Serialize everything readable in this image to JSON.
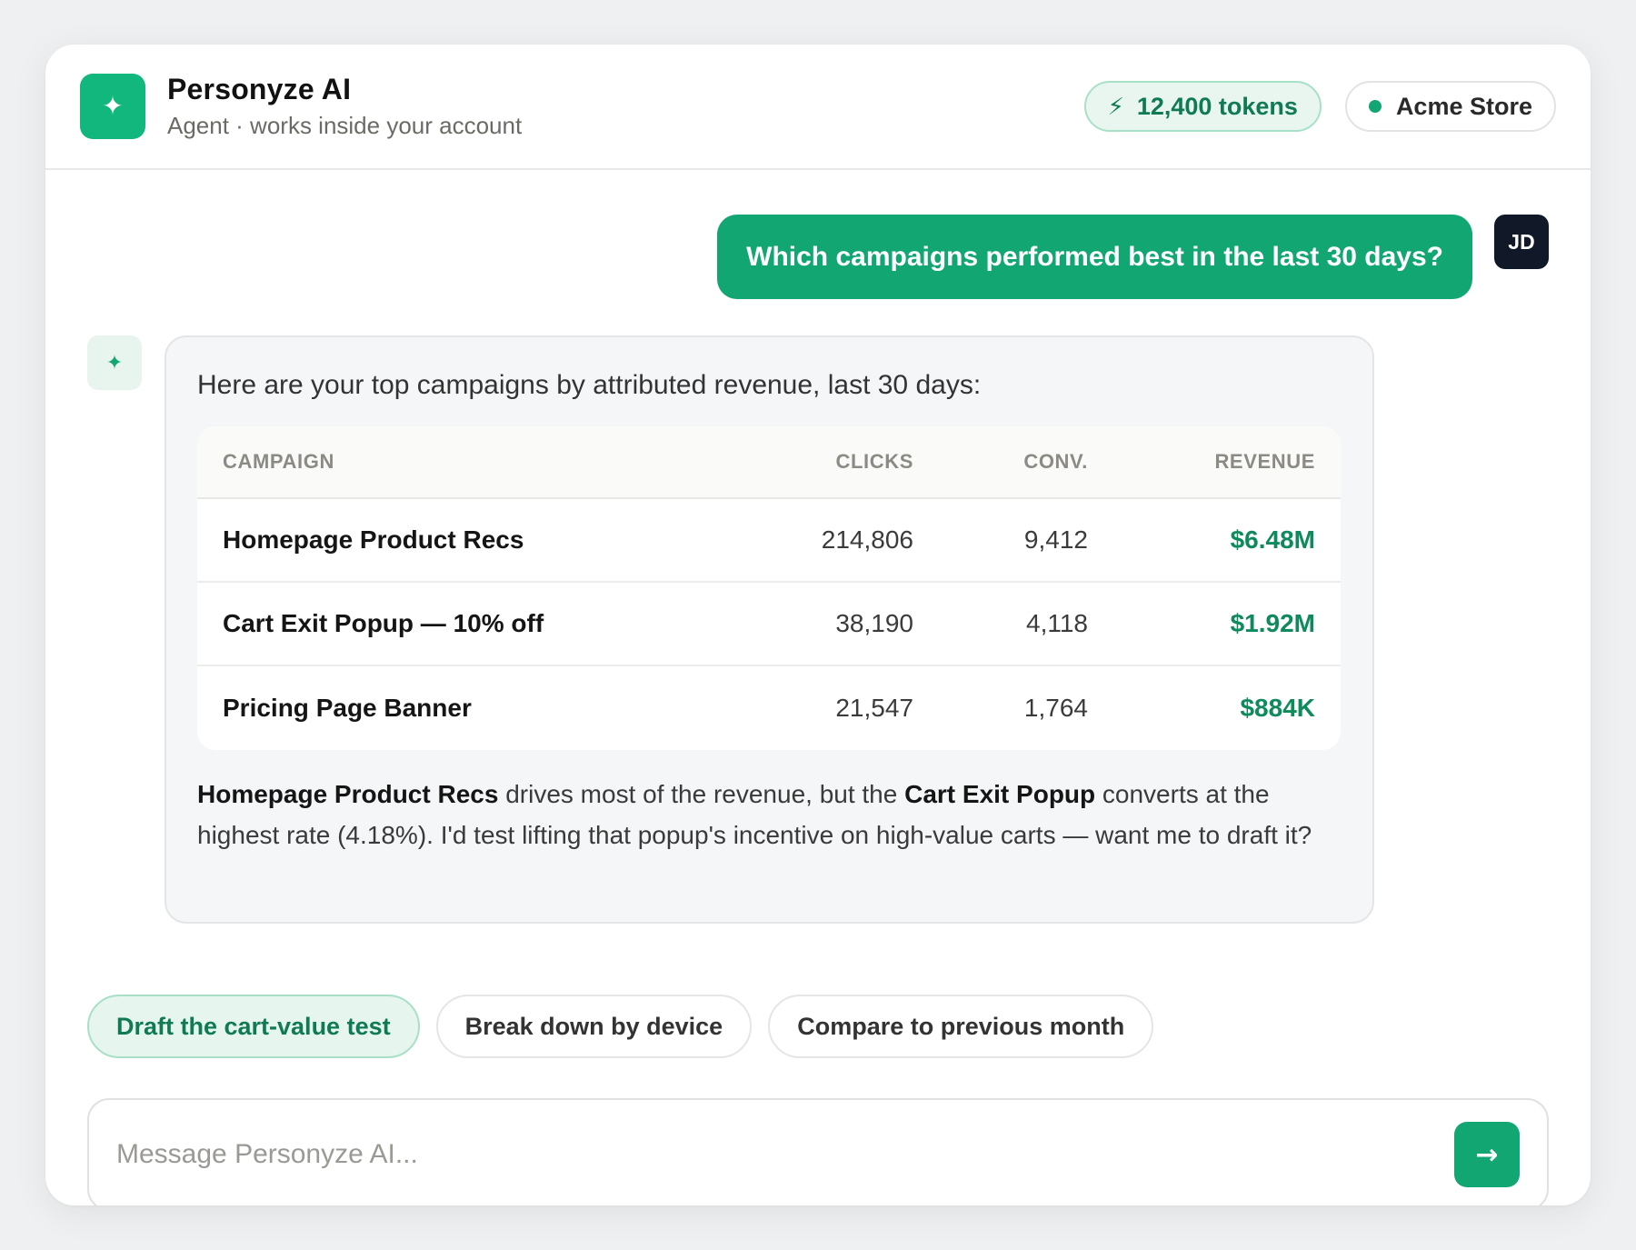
{
  "header": {
    "title": "Personyze AI",
    "subtitle": "Agent · works inside your account",
    "logo_icon": "sparkle-icon",
    "tokens_label": "12,400 tokens",
    "store_label": "Acme Store"
  },
  "user_message": {
    "text": "Which campaigns performed best in the last 30 days?",
    "avatar_initials": "JD"
  },
  "agent_message": {
    "intro": "Here are your top campaigns by attributed revenue, last 30 days:",
    "table": {
      "headers": [
        "CAMPAIGN",
        "CLICKS",
        "CONV.",
        "REVENUE"
      ],
      "rows": [
        {
          "campaign": "Homepage Product Recs",
          "clicks": "214,806",
          "conv": "9,412",
          "revenue": "$6.48M"
        },
        {
          "campaign": "Cart Exit Popup — 10% off",
          "clicks": "38,190",
          "conv": "4,118",
          "revenue": "$1.92M"
        },
        {
          "campaign": "Pricing Page Banner",
          "clicks": "21,547",
          "conv": "1,764",
          "revenue": "$884K"
        }
      ]
    },
    "summary": {
      "bold1": "Homepage Product Recs",
      "text1": " drives most of the revenue, but the ",
      "bold2": "Cart Exit Popup",
      "text2": " converts at the highest rate (4.18%). I'd test lifting that popup's incentive on high-value carts — want me to draft it?"
    }
  },
  "suggestions": [
    "Draft the cart-value test",
    "Break down by device",
    "Compare to previous month"
  ],
  "composer": {
    "placeholder": "Message Personyze AI..."
  },
  "colors": {
    "accent": "#12a673",
    "accent_dark": "#0f8a5c",
    "user_avatar": "#111827"
  }
}
